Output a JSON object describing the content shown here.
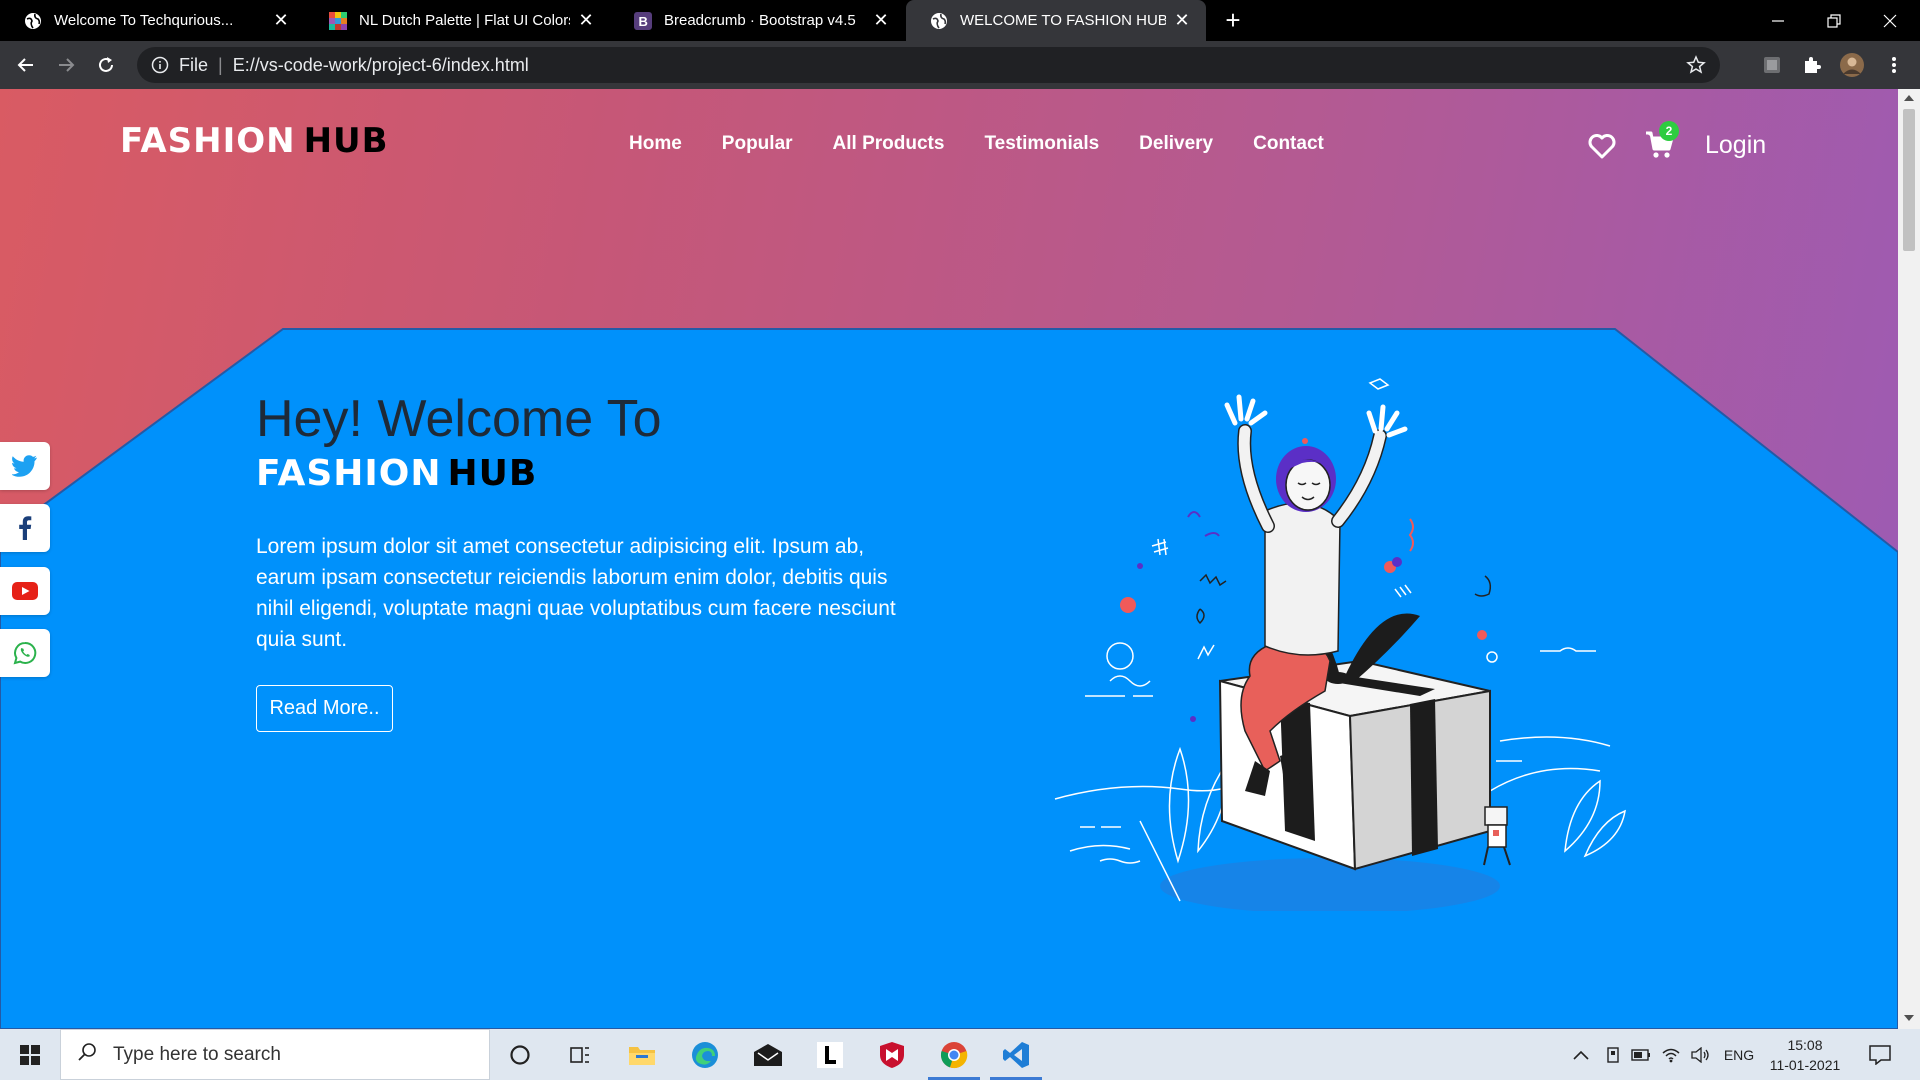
{
  "browser": {
    "tabs": [
      {
        "title": "Welcome To Techqurious...",
        "active": false
      },
      {
        "title": "NL Dutch Palette | Flat UI Colors",
        "active": false
      },
      {
        "title": "Breadcrumb · Bootstrap v4.5",
        "active": false
      },
      {
        "title": "WELCOME TO FASHION HUB",
        "active": true
      }
    ],
    "address": {
      "scheme_label": "File",
      "url": "E://vs-code-work/project-6/index.html"
    }
  },
  "site": {
    "logo": {
      "part1": "FASHION",
      "part2": "HUB"
    },
    "nav": [
      "Home",
      "Popular",
      "All Products",
      "Testimonials",
      "Delivery",
      "Contact"
    ],
    "cart_count": "2",
    "login_label": "Login",
    "hero": {
      "title": "Hey! Welcome To",
      "brand_part1": "FASHION",
      "brand_part2": "HUB",
      "description": "Lorem ipsum dolor sit amet consectetur adipisicing elit. Ipsum ab, earum ipsam consectetur reiciendis laborum enim dolor, debitis quis nihil eligendi, voluptate magni quae voluptatibus cum facere nesciunt quia sunt.",
      "button_label": "Read More.."
    },
    "social": [
      "twitter-icon",
      "facebook-icon",
      "youtube-icon",
      "whatsapp-icon"
    ],
    "colors": {
      "hero_blue": "#0093ff",
      "gradient_start": "#d95b63",
      "gradient_end": "#9b5bb6",
      "title_dark": "#1e2a38",
      "badge_green": "#2ecc40"
    }
  },
  "taskbar": {
    "search_placeholder": "Type here to search",
    "language": "ENG",
    "time": "15:08",
    "date": "11-01-2021"
  }
}
